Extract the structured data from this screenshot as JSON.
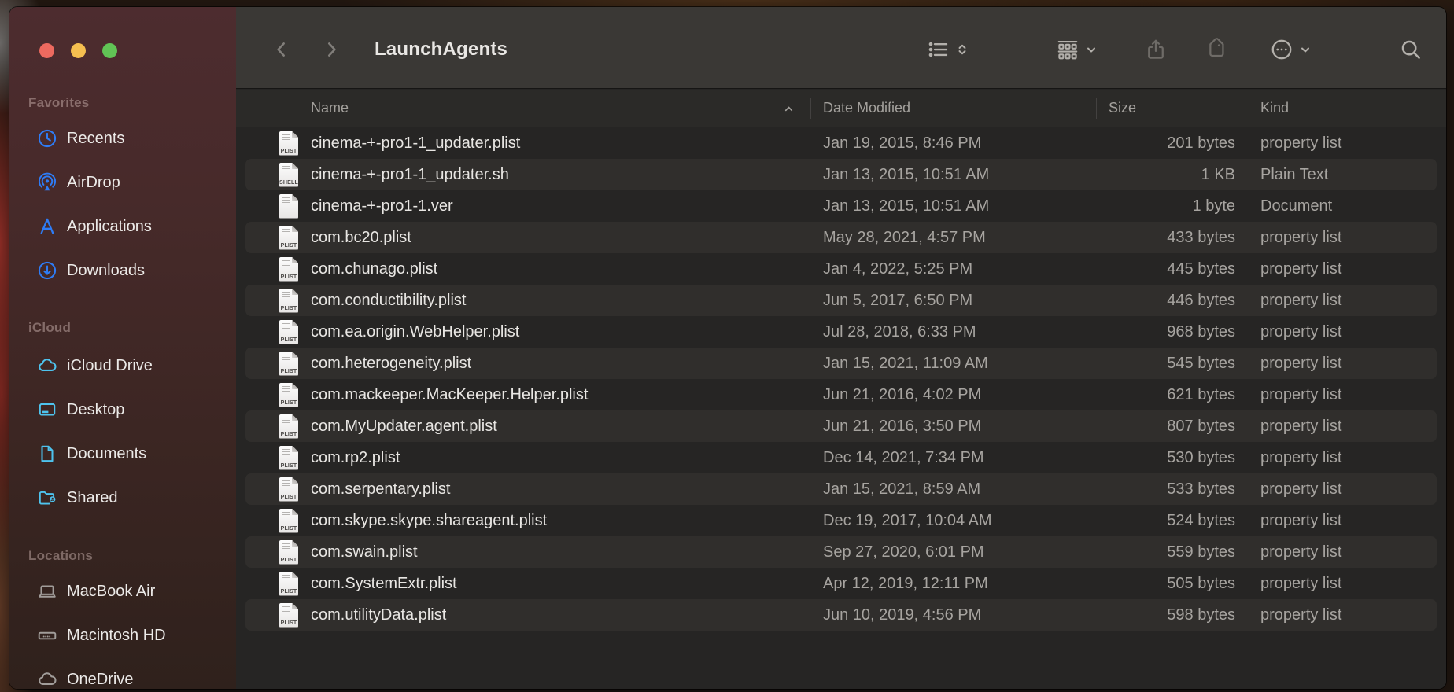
{
  "window": {
    "title": "LaunchAgents"
  },
  "toolbar": {
    "back_icon": "chevron-left-icon",
    "forward_icon": "chevron-right-icon",
    "buttons": [
      "list-view-button",
      "group-by-button",
      "share-button",
      "tag-button",
      "more-actions-button",
      "search-button"
    ]
  },
  "sidebar": {
    "sections": [
      {
        "label": "Favorites",
        "icon_color": "#2e7cf6",
        "items": [
          {
            "label": "Recents",
            "icon": "clock-icon"
          },
          {
            "label": "AirDrop",
            "icon": "airdrop-icon"
          },
          {
            "label": "Applications",
            "icon": "app-store-icon"
          },
          {
            "label": "Downloads",
            "icon": "download-circle-icon"
          }
        ]
      },
      {
        "label": "iCloud",
        "icon_color": "#4ec3ee",
        "items": [
          {
            "label": "iCloud Drive",
            "icon": "cloud-icon"
          },
          {
            "label": "Desktop",
            "icon": "desktop-icon"
          },
          {
            "label": "Documents",
            "icon": "document-icon"
          },
          {
            "label": "Shared",
            "icon": "shared-folder-icon"
          }
        ]
      },
      {
        "label": "Locations",
        "icon_color": "#a19d9a",
        "items": [
          {
            "label": "MacBook Air",
            "icon": "laptop-icon"
          },
          {
            "label": "Macintosh HD",
            "icon": "hard-drive-icon"
          },
          {
            "label": "OneDrive",
            "icon": "cloud-icon"
          }
        ]
      }
    ]
  },
  "table": {
    "columns": [
      "Name",
      "Date Modified",
      "Size",
      "Kind"
    ],
    "sort_column": "Name",
    "sort_direction": "ascending",
    "rows": [
      {
        "name": "cinema-+-pro1-1_updater.plist",
        "badge": "PLIST",
        "date": "Jan 19, 2015, 8:46 PM",
        "size": "201 bytes",
        "kind": "property list"
      },
      {
        "name": "cinema-+-pro1-1_updater.sh",
        "badge": "SHELL",
        "date": "Jan 13, 2015, 10:51 AM",
        "size": "1 KB",
        "kind": "Plain Text"
      },
      {
        "name": "cinema-+-pro1-1.ver",
        "badge": null,
        "date": "Jan 13, 2015, 10:51 AM",
        "size": "1 byte",
        "kind": "Document"
      },
      {
        "name": "com.bc20.plist",
        "badge": "PLIST",
        "date": "May 28, 2021, 4:57 PM",
        "size": "433 bytes",
        "kind": "property list"
      },
      {
        "name": "com.chunago.plist",
        "badge": "PLIST",
        "date": "Jan 4, 2022, 5:25 PM",
        "size": "445 bytes",
        "kind": "property list"
      },
      {
        "name": "com.conductibility.plist",
        "badge": "PLIST",
        "date": "Jun 5, 2017, 6:50 PM",
        "size": "446 bytes",
        "kind": "property list"
      },
      {
        "name": "com.ea.origin.WebHelper.plist",
        "badge": "PLIST",
        "date": "Jul 28, 2018, 6:33 PM",
        "size": "968 bytes",
        "kind": "property list"
      },
      {
        "name": "com.heterogeneity.plist",
        "badge": "PLIST",
        "date": "Jan 15, 2021, 11:09 AM",
        "size": "545 bytes",
        "kind": "property list"
      },
      {
        "name": "com.mackeeper.MacKeeper.Helper.plist",
        "badge": "PLIST",
        "date": "Jun 21, 2016, 4:02 PM",
        "size": "621 bytes",
        "kind": "property list"
      },
      {
        "name": "com.MyUpdater.agent.plist",
        "badge": "PLIST",
        "date": "Jun 21, 2016, 3:50 PM",
        "size": "807 bytes",
        "kind": "property list"
      },
      {
        "name": "com.rp2.plist",
        "badge": "PLIST",
        "date": "Dec 14, 2021, 7:34 PM",
        "size": "530 bytes",
        "kind": "property list"
      },
      {
        "name": "com.serpentary.plist",
        "badge": "PLIST",
        "date": "Jan 15, 2021, 8:59 AM",
        "size": "533 bytes",
        "kind": "property list"
      },
      {
        "name": "com.skype.skype.shareagent.plist",
        "badge": "PLIST",
        "date": "Dec 19, 2017, 10:04 AM",
        "size": "524 bytes",
        "kind": "property list"
      },
      {
        "name": "com.swain.plist",
        "badge": "PLIST",
        "date": "Sep 27, 2020, 6:01 PM",
        "size": "559 bytes",
        "kind": "property list"
      },
      {
        "name": "com.SystemExtr.plist",
        "badge": "PLIST",
        "date": "Apr 12, 2019, 12:11 PM",
        "size": "505 bytes",
        "kind": "property list"
      },
      {
        "name": "com.utilityData.plist",
        "badge": "PLIST",
        "date": "Jun 10, 2019, 4:56 PM",
        "size": "598 bytes",
        "kind": "property list"
      }
    ]
  },
  "colors": {
    "traffic_close": "#ed6a5f",
    "traffic_minimize": "#f5bf50",
    "traffic_zoom": "#61c455",
    "favorites_icon": "#2e7cf6",
    "icloud_icon": "#4ec3ee",
    "locations_icon": "#a19d9a"
  }
}
